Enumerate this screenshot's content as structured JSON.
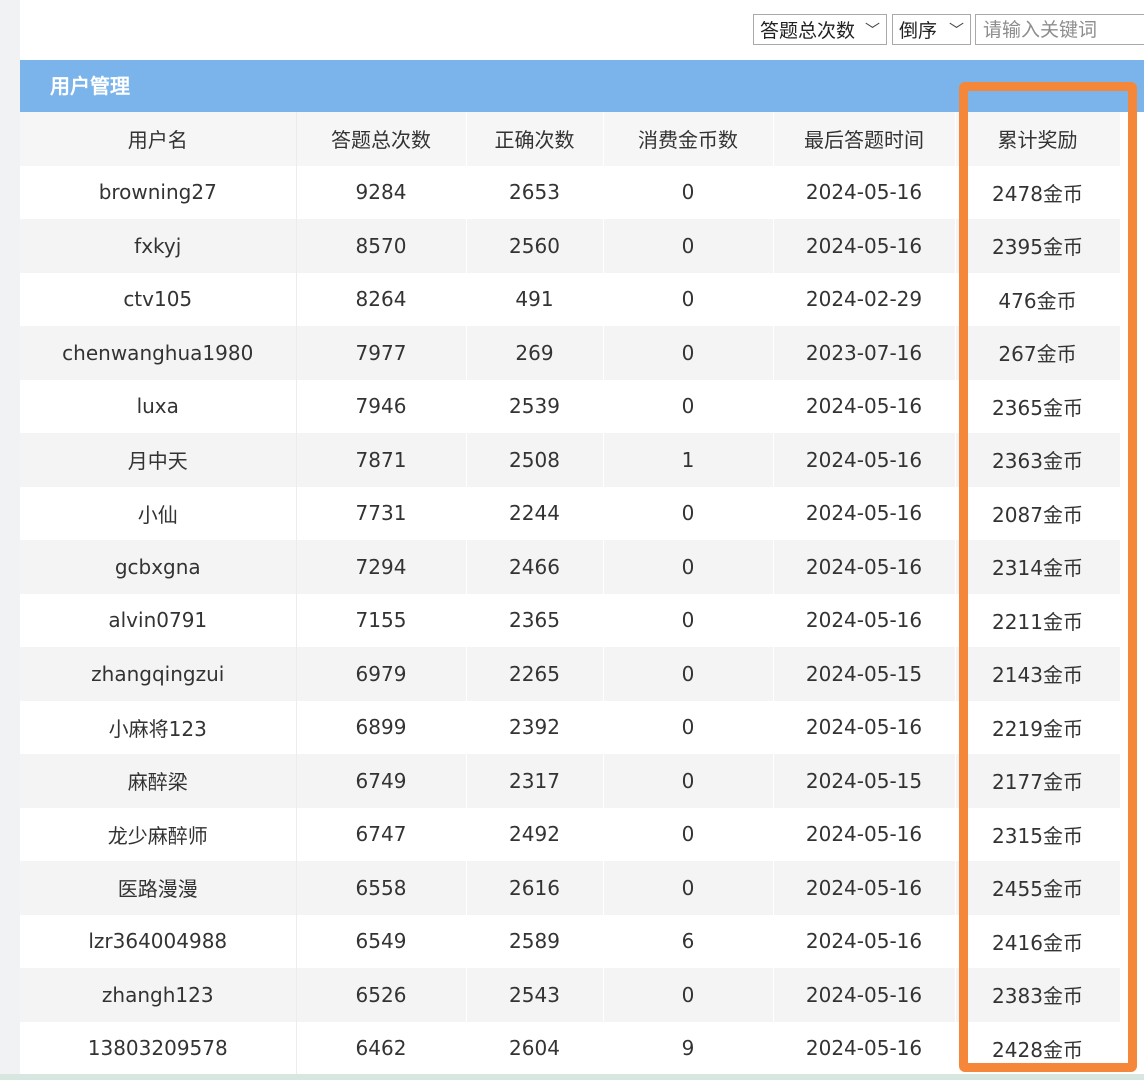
{
  "toolbar": {
    "sort_field": "答题总次数",
    "sort_order": "倒序",
    "search_placeholder": "请输入关键词"
  },
  "panel": {
    "title": "用户管理"
  },
  "table": {
    "columns": [
      "用户名",
      "答题总次数",
      "正确次数",
      "消费金币数",
      "最后答题时间",
      "累计奖励"
    ],
    "rows": [
      [
        "browning27",
        "9284",
        "2653",
        "0",
        "2024-05-16",
        "2478金币"
      ],
      [
        "fxkyj",
        "8570",
        "2560",
        "0",
        "2024-05-16",
        "2395金币"
      ],
      [
        "ctv105",
        "8264",
        "491",
        "0",
        "2024-02-29",
        "476金币"
      ],
      [
        "chenwanghua1980",
        "7977",
        "269",
        "0",
        "2023-07-16",
        "267金币"
      ],
      [
        "luxa",
        "7946",
        "2539",
        "0",
        "2024-05-16",
        "2365金币"
      ],
      [
        "月中天",
        "7871",
        "2508",
        "1",
        "2024-05-16",
        "2363金币"
      ],
      [
        "小仙",
        "7731",
        "2244",
        "0",
        "2024-05-16",
        "2087金币"
      ],
      [
        "gcbxgna",
        "7294",
        "2466",
        "0",
        "2024-05-16",
        "2314金币"
      ],
      [
        "alvin0791",
        "7155",
        "2365",
        "0",
        "2024-05-16",
        "2211金币"
      ],
      [
        "zhangqingzui",
        "6979",
        "2265",
        "0",
        "2024-05-15",
        "2143金币"
      ],
      [
        "小麻将123",
        "6899",
        "2392",
        "0",
        "2024-05-16",
        "2219金币"
      ],
      [
        "麻醉梁",
        "6749",
        "2317",
        "0",
        "2024-05-15",
        "2177金币"
      ],
      [
        "龙少麻醉师",
        "6747",
        "2492",
        "0",
        "2024-05-16",
        "2315金币"
      ],
      [
        "医路漫漫",
        "6558",
        "2616",
        "0",
        "2024-05-16",
        "2455金币"
      ],
      [
        "lzr364004988",
        "6549",
        "2589",
        "6",
        "2024-05-16",
        "2416金币"
      ],
      [
        "zhangh123",
        "6526",
        "2543",
        "0",
        "2024-05-16",
        "2383金币"
      ],
      [
        "13803209578",
        "6462",
        "2604",
        "9",
        "2024-05-16",
        "2428金币"
      ]
    ]
  },
  "colors": {
    "header_bar": "#7bb4ea",
    "highlight_box": "#f5873a"
  }
}
